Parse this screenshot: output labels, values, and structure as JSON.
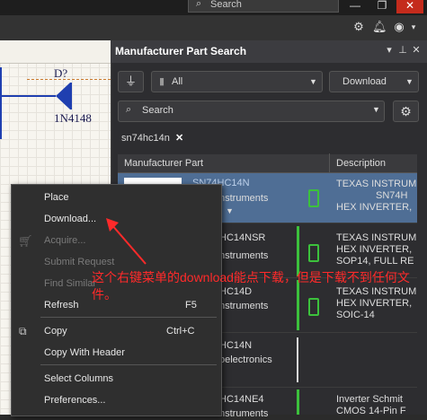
{
  "titlebar": {
    "search_label": "Search",
    "window_buttons": [
      "—",
      "❐",
      "✕"
    ]
  },
  "schematic": {
    "designator": "D?",
    "part": "1N4148"
  },
  "panel": {
    "title": "Manufacturer Part Search",
    "filter_select": "All",
    "download_button": "Download",
    "search_placeholder": "Search",
    "search_chip": "sn74hc14n",
    "columns": {
      "mfr_part": "Manufacturer Part",
      "description": "Description"
    },
    "rows": [
      {
        "part": "SN74HC14N",
        "mfr": "nstruments",
        "desc": [
          "TEXAS INSTRUM",
          "SN74H",
          "HEX INVERTER,"
        ]
      },
      {
        "part": "HC14NSR",
        "mfr": "nstruments",
        "desc": [
          "TEXAS INSTRUM",
          "HEX INVERTER,",
          "SOP14, FULL RE"
        ]
      },
      {
        "part": "HC14D",
        "mfr": "nstruments",
        "desc": [
          "TEXAS INSTRUM",
          "HEX INVERTER,",
          "SOIC-14"
        ]
      },
      {
        "part": "HC14N",
        "mfr": "oelectronics",
        "desc": []
      },
      {
        "part": "HC14NE4",
        "mfr": "nstruments",
        "desc": [
          "Inverter Schmit",
          "CMOS 14-Pin F"
        ]
      }
    ]
  },
  "context_menu": {
    "items": [
      {
        "label": "Place",
        "shortcut": "",
        "disabled": false
      },
      {
        "label": "Download...",
        "shortcut": "",
        "disabled": false
      },
      {
        "label": "Acquire...",
        "shortcut": "",
        "disabled": true
      },
      {
        "label": "Submit Request",
        "shortcut": "",
        "disabled": true
      },
      {
        "label": "Find Similar",
        "shortcut": "",
        "disabled": true
      },
      {
        "label": "Refresh",
        "shortcut": "F5",
        "disabled": false
      },
      {
        "label": "Copy",
        "shortcut": "Ctrl+C",
        "disabled": false
      },
      {
        "label": "Copy With Header",
        "shortcut": "",
        "disabled": false
      },
      {
        "label": "Select Columns",
        "shortcut": "",
        "disabled": false
      },
      {
        "label": "Preferences...",
        "shortcut": "",
        "disabled": false
      }
    ]
  },
  "annotation": "这个右键菜单的download能点下载，但是下载不到任何文件。",
  "colors": {
    "accent_green": "#3cc13c",
    "selected_row": "#4f6e95",
    "annotation_red": "#ff2a2a"
  }
}
